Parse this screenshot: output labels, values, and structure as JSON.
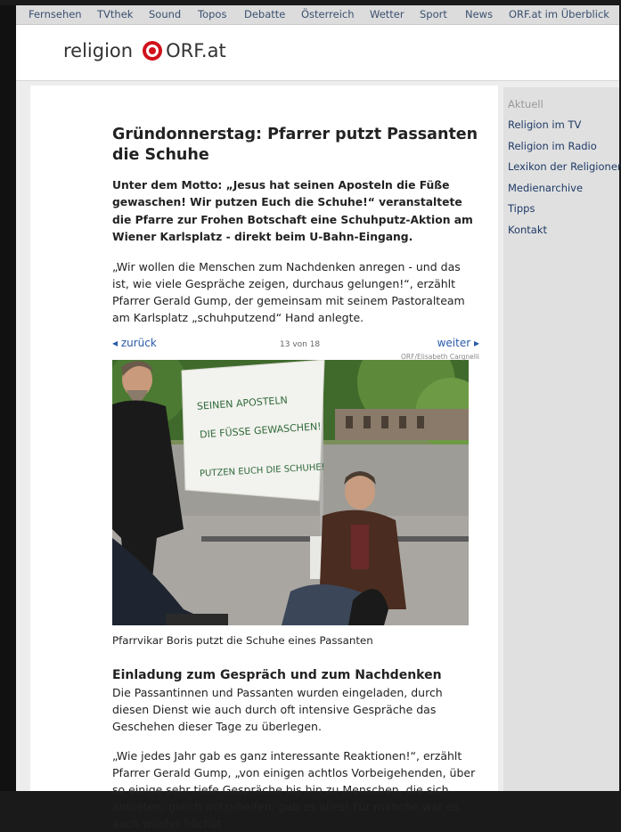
{
  "topnav": {
    "items": [
      "Fernsehen",
      "TVthek",
      "Sound",
      "Topos",
      "Debatte",
      "Österreich",
      "Wetter",
      "Sport",
      "News",
      "ORF.at im Überblick"
    ]
  },
  "header": {
    "section": "religion",
    "logo_text": "ORF.at"
  },
  "sidebar": {
    "items": [
      "Aktuell",
      "Religion im TV",
      "Religion im Radio",
      "Lexikon der Religionen",
      "Medienarchive",
      "Tipps",
      "Kontakt"
    ]
  },
  "article": {
    "title": "Gründonnerstag: Pfarrer putzt Passanten die Schuhe",
    "lead": "Unter dem Motto: „Jesus hat seinen Aposteln die Füße gewaschen! Wir putzen Euch die Schuhe!“ veranstaltete die Pfarre zur Frohen Botschaft eine Schuhputz-Aktion am Wiener Karlsplatz - direkt beim U-Bahn-Eingang.",
    "paragraph1": "„Wir wollen die Menschen zum Nachdenken anregen - und das ist, wie viele Gespräche zeigen, durchaus gelungen!“, erzählt Pfarrer Gerald Gump, der gemeinsam mit seinem Pastoralteam am Karlsplatz „schuhputzend“ Hand anlegte.",
    "gallery": {
      "prev": "◂ zurück",
      "counter": "13 von 18",
      "next": "weiter ▸",
      "credit": "ORF/Elisabeth Cargnelli",
      "caption": "Pfarrvikar Boris putzt die Schuhe eines Passanten",
      "banner_line1": "SEINEN APOSTELN",
      "banner_line2": "DIE FÜSSE GEWASCHEN!",
      "banner_line3": "PUTZEN EUCH DIE SCHUHE!"
    },
    "subheading": "Einladung zum Gespräch und zum Nachdenken",
    "paragraph2": "Die Passantinnen und Passanten wurden eingeladen, durch diesen Dienst wie auch durch oft intensive Gespräche das Geschehen dieser Tage zu überlegen.",
    "paragraph3": "„Wie jedes Jahr gab es ganz interessante Reaktionen!“, erzählt Pfarrer Gerald Gump, „von einigen achtlos Vorbeigehenden, über so einige sehr tiefe Gespräche bis hin zu Menschen, die sich anbieten, gleich mitzuhelfen, gab es alles! Für manche war es auch wieder höchst"
  },
  "colors": {
    "link": "#2a5aa8",
    "logo_red": "#d1111c",
    "sidebar_bg": "#e0e0e0"
  }
}
